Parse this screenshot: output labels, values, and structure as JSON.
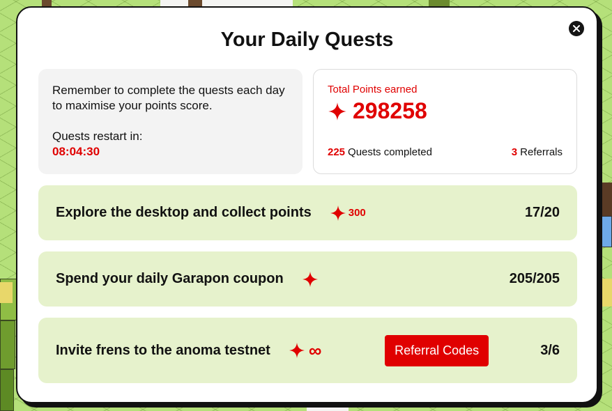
{
  "modal": {
    "title": "Your Daily Quests",
    "close_icon": "close-icon"
  },
  "info": {
    "reminder": "Remember to complete the quests each day to maximise your points score.",
    "restart_label": "Quests restart in:",
    "restart_time": "08:04:30"
  },
  "points": {
    "label": "Total Points earned",
    "icon": "sparkle-icon",
    "value": "298258",
    "quests_completed_count": "225",
    "quests_completed_label": "Quests completed",
    "referrals_count": "3",
    "referrals_label": "Referrals"
  },
  "quests": [
    {
      "name": "Explore the desktop and collect points",
      "reward_icon": "sparkle-icon",
      "reward": "300",
      "progress": "17/20"
    },
    {
      "name": "Spend your daily Garapon coupon",
      "reward_icon": "sparkle-icon",
      "reward": "",
      "progress": "205/205"
    },
    {
      "name": "Invite frens to the anoma testnet",
      "reward_icon": "sparkle-icon",
      "reward": "∞",
      "button_label": "Referral Codes",
      "progress": "3/6"
    }
  ],
  "colors": {
    "accent_red": "#e00000",
    "quest_bg": "#e6f2cc",
    "info_bg": "#f3f3f3",
    "background_green": "#b5e07a"
  }
}
